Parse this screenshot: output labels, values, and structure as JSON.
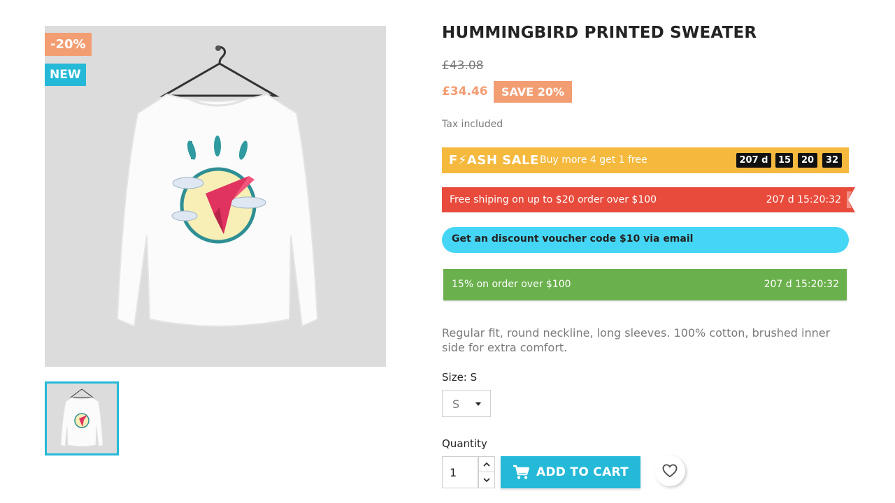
{
  "product": {
    "title": "HUMMINGBIRD PRINTED SWEATER",
    "regular_price": "£43.08",
    "price": "£34.46",
    "save_badge": "SAVE 20%",
    "tax_note": "Tax included",
    "description": "Regular fit, round neckline, long sleeves. 100% cotton, brushed inner side for extra comfort."
  },
  "flags": {
    "discount": "-20%",
    "new": "NEW"
  },
  "flash_sale": {
    "title": "F⚡ASH SALE",
    "subtitle": "Buy more 4 get 1 free",
    "days": "207 d",
    "hours": "15",
    "minutes": "20",
    "seconds": "32"
  },
  "shipping_banner": {
    "text": "Free shiping on up to $20 order over $100",
    "timer": "207 d 15:20:32"
  },
  "voucher_banner": {
    "text": "Get an discount voucher code $10 via email"
  },
  "promo_banner": {
    "text": "15% on order over $100",
    "timer": "207 d 15:20:32"
  },
  "size": {
    "label": "Size: S",
    "selected": "S"
  },
  "quantity": {
    "label": "Quantity",
    "value": "1"
  },
  "cart": {
    "add_label": "ADD TO CART"
  },
  "colors": {
    "accent": "#24b9d7",
    "discount": "#f39d72",
    "flash": "#f5b93e",
    "shipping": "#e84b3c",
    "voucher": "#45d6f5",
    "promo": "#6ab04c"
  },
  "icons": {
    "cart": "shopping-cart-icon",
    "wishlist": "heart-icon",
    "size_select": "caret-down-icon",
    "qty_up": "chevron-up-icon",
    "qty_down": "chevron-down-icon"
  }
}
